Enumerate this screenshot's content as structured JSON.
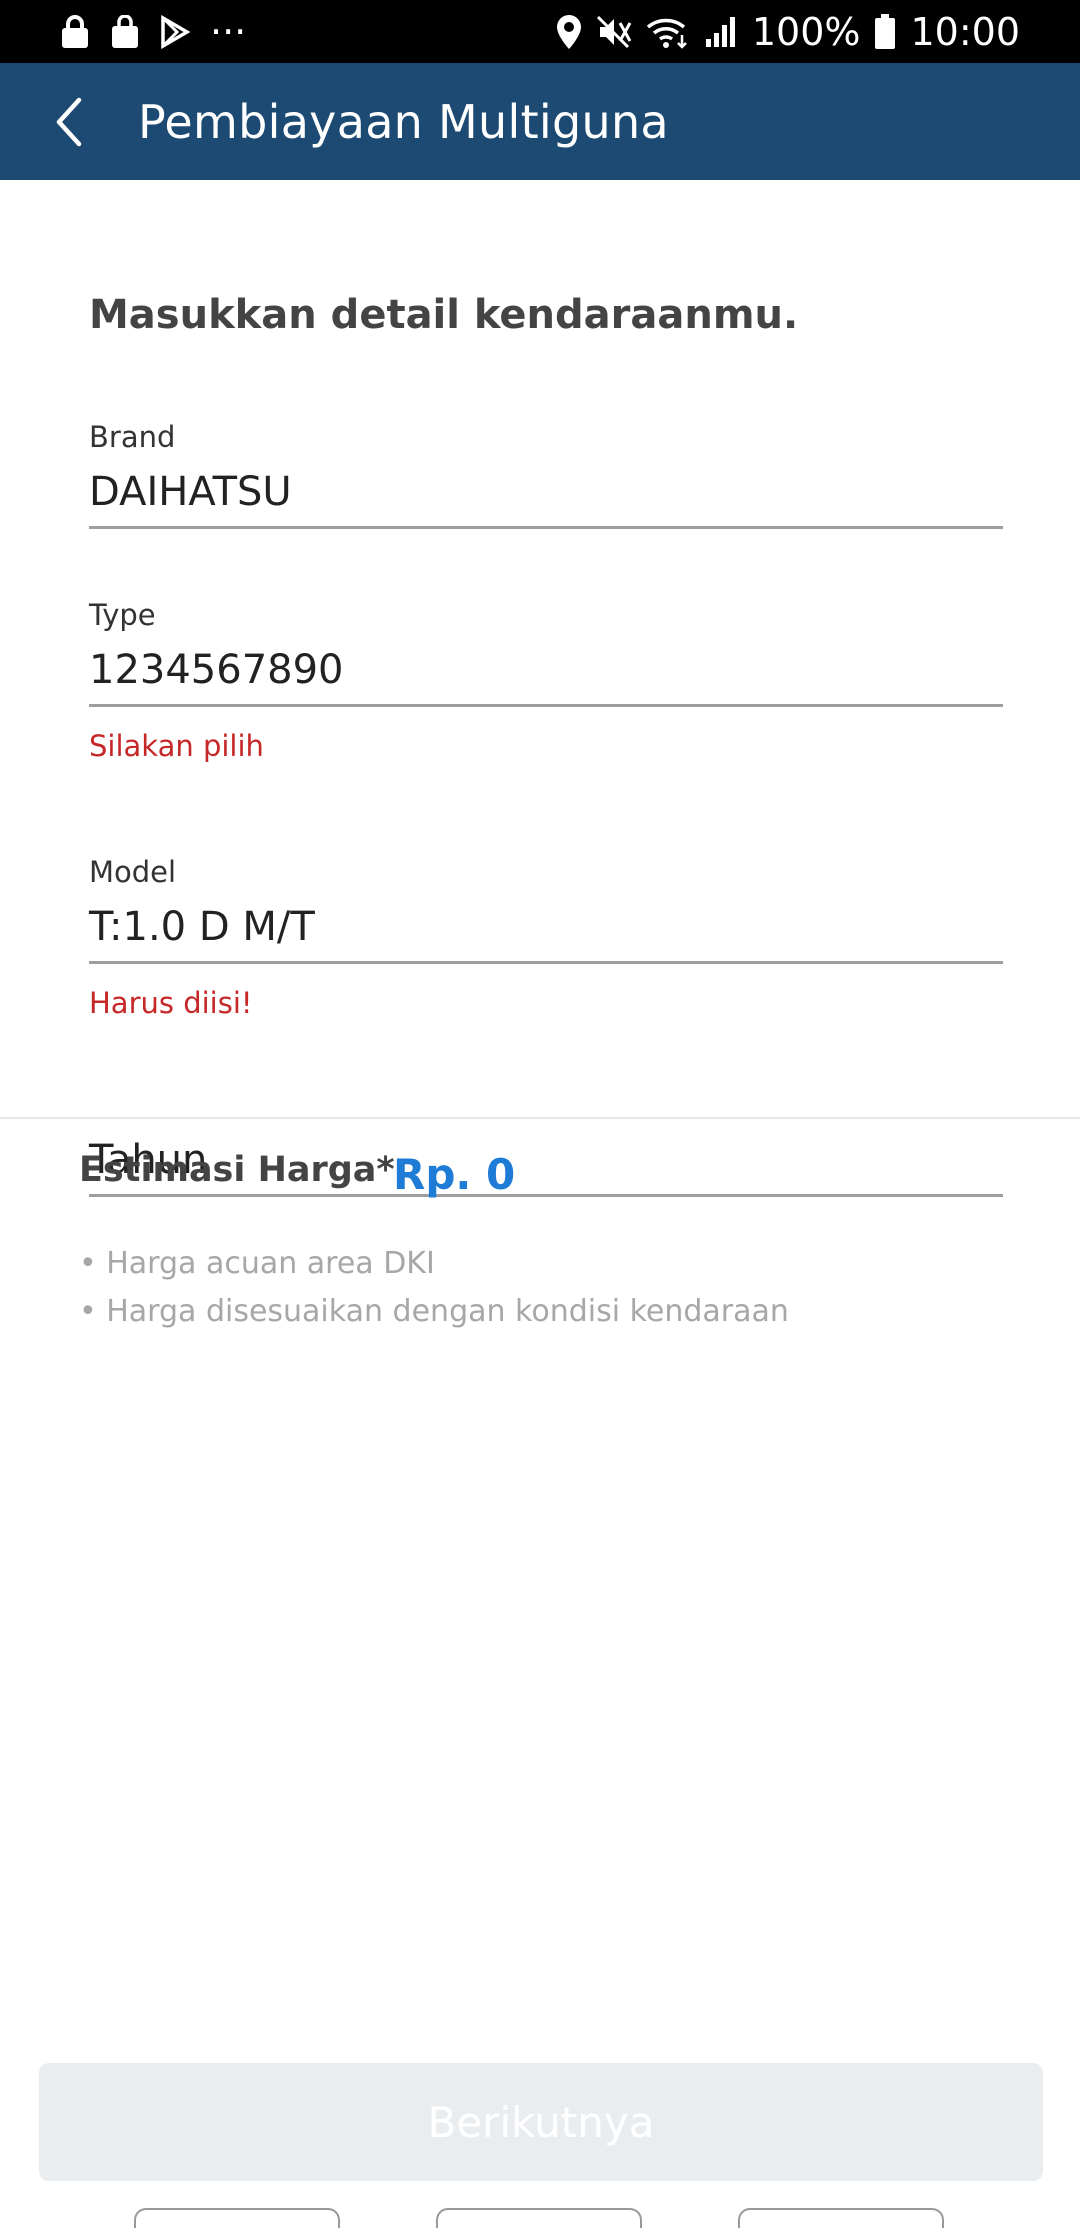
{
  "status_bar": {
    "battery": "100%",
    "time": "10:00",
    "more": "···",
    "icons": [
      "lock-icon",
      "bag-icon",
      "play-store-icon",
      "more-icon",
      "location-icon",
      "mute-icon",
      "wifi-icon",
      "signal-icon",
      "battery-icon"
    ]
  },
  "app_bar": {
    "title": "Pembiayaan Multiguna",
    "back_icon": "chevron-left-icon"
  },
  "form": {
    "heading": "Masukkan detail kendaraanmu.",
    "brand": {
      "label": "Brand",
      "value": "DAIHATSU"
    },
    "type": {
      "label": "Type",
      "value": "1234567890",
      "error": "Silakan pilih"
    },
    "model": {
      "label": "Model",
      "value": "T:1.0 D M/T",
      "error": "Harus diisi!"
    },
    "tahun": {
      "placeholder": "Tahun"
    }
  },
  "estimate": {
    "label": "Estimasi Harga*",
    "value": "Rp. 0",
    "notes": [
      "• Harga acuan area DKI",
      "• Harga disesuaikan dengan kondisi kendaraan"
    ]
  },
  "next_button": {
    "label": "Berikutnya"
  },
  "colors": {
    "app_bar": "#1d4a73",
    "error": "#c62828",
    "price": "#1e7bd6",
    "button_disabled": "#eaedf0"
  }
}
